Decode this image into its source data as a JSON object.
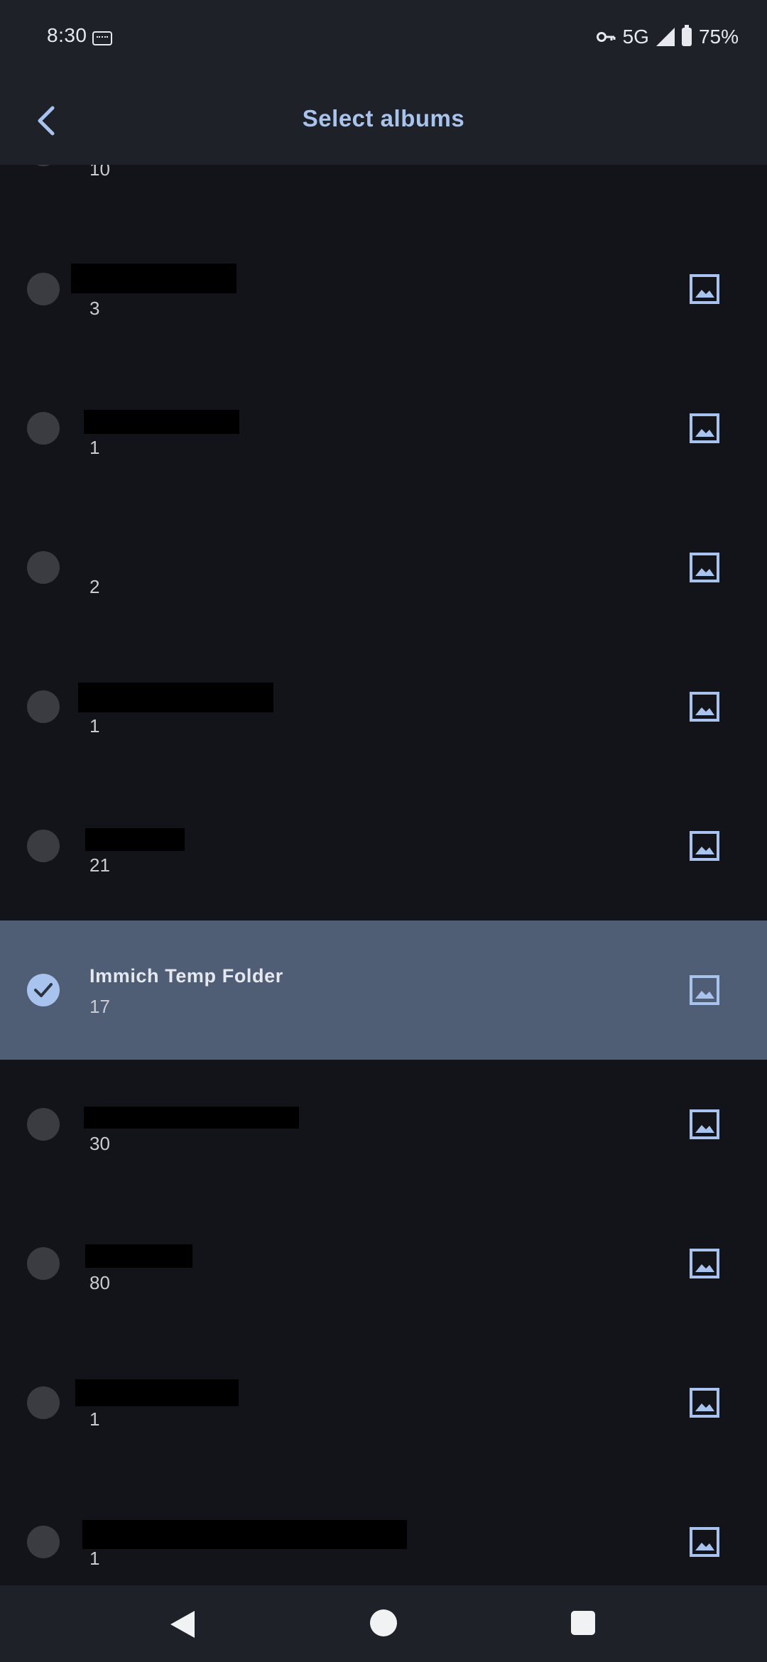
{
  "status_bar": {
    "time": "8:30",
    "network": "5G",
    "battery": "75%",
    "icons": [
      "sim-card-icon",
      "vpn-key-icon",
      "signal-icon",
      "battery-icon"
    ]
  },
  "app_bar": {
    "title": "Select albums",
    "back_icon": "chevron-left-icon"
  },
  "albums": [
    {
      "name": "",
      "count": "10",
      "selected": false
    },
    {
      "name": "",
      "count": "3",
      "selected": false
    },
    {
      "name": "",
      "count": "1",
      "selected": false
    },
    {
      "name": "",
      "count": "2",
      "selected": false
    },
    {
      "name": "",
      "count": "1",
      "selected": false
    },
    {
      "name": "",
      "count": "21",
      "selected": false
    },
    {
      "name": "Immich Temp Folder",
      "count": "17",
      "selected": true
    },
    {
      "name": "",
      "count": "30",
      "selected": false
    },
    {
      "name": "",
      "count": "80",
      "selected": false
    },
    {
      "name": "",
      "count": "1",
      "selected": false
    },
    {
      "name": "",
      "count": "1",
      "selected": false
    }
  ],
  "nav_bar": {
    "icons": [
      "back-triangle-icon",
      "home-circle-icon",
      "recents-square-icon"
    ]
  },
  "colors": {
    "background": "#12141a",
    "bar": "#1e2127",
    "accent": "#a9c3ef",
    "selected_row": "#4f5d75"
  }
}
